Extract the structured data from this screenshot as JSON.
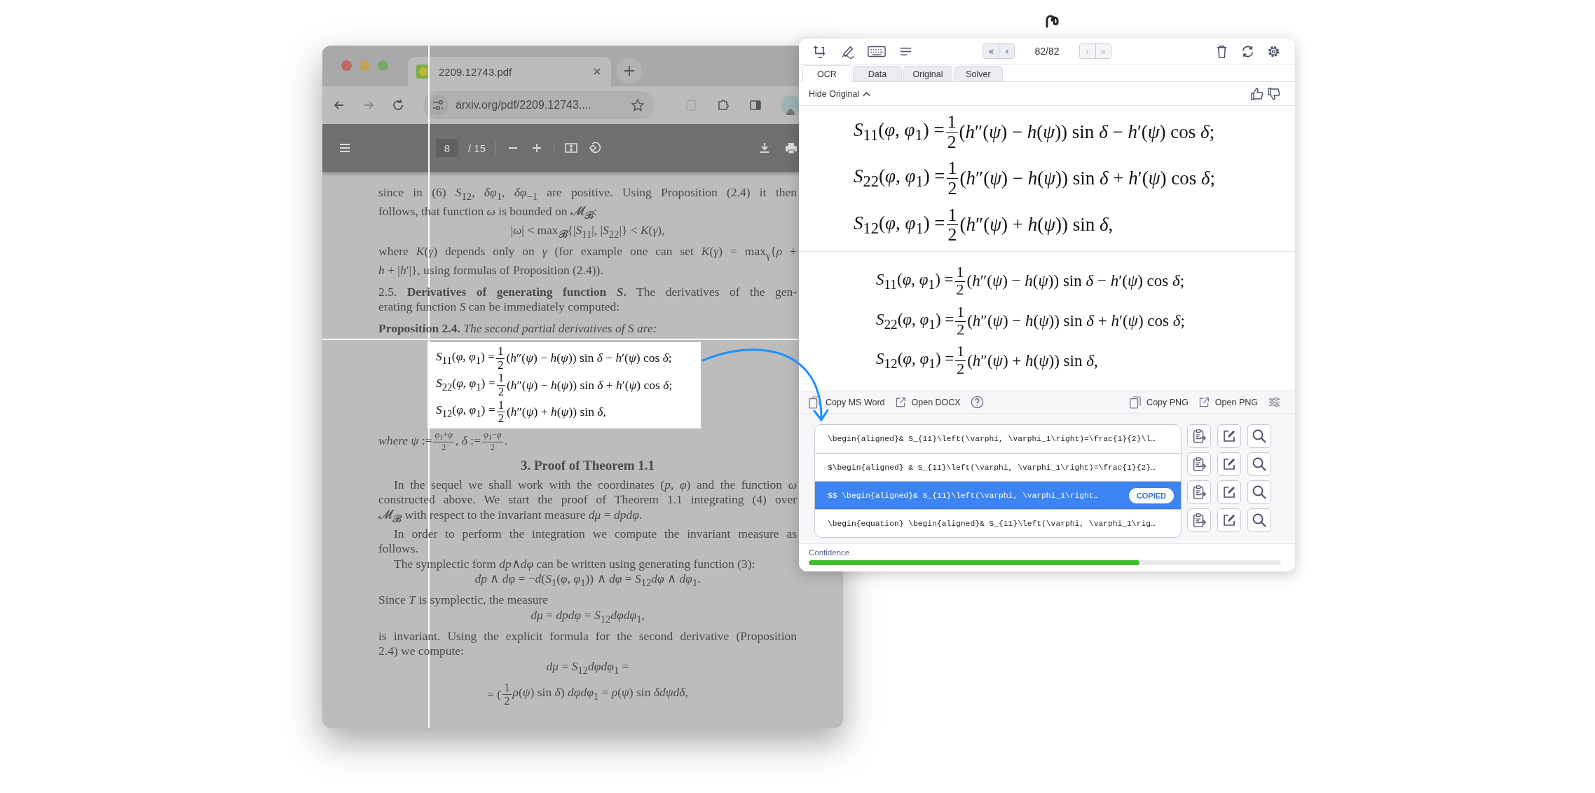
{
  "browser": {
    "tab_title": "2209.12743.pdf",
    "url": "arxiv.org/pdf/2209.12743....",
    "page_number": "8",
    "page_total": "/ 15"
  },
  "pdf_page": {
    "blocks": [
      {
        "kind": "para",
        "lines": [
          "since in (6) *S*$_{12}$, *δφ*$_{1}$, *δφ*$_{−1}$ are positive.  Using Proposition (2.4) it then",
          "follows, that function *ω* is bounded on 𝓜$_{𝓑}$:"
        ]
      },
      {
        "kind": "display",
        "parts": [
          {
            "kind": "text",
            "text": "|*ω*| < max$_{𝓑}${|*S*$_{11}$|, |*S*$_{22}$|} < *K*(*γ*),"
          }
        ]
      },
      {
        "kind": "para",
        "lines": [
          "where *K*(*γ*) depends only on *γ* (for example one can set *K*(*γ*) = max$_{γ}${*ρ* +",
          "*h* + |*h*′|}, using formulas of Proposition (2.4))."
        ]
      },
      {
        "kind": "para",
        "lines": [
          "2.5. **Derivatives of generating function** ***S*.** The derivatives of the gen-",
          "erating function *S* can be immediately computed:"
        ]
      },
      {
        "kind": "para",
        "lines": [
          "**Proposition 2.4.** *The second partial derivatives of S are:*"
        ]
      },
      {
        "kind": "selection",
        "equations": [
          {
            "parts": [
              {
                "kind": "text",
                "text": "*S*$_{11}$(*φ*, *φ*$_{1}$) ="
              },
              {
                "kind": "frac",
                "num": "1",
                "den": "2"
              },
              {
                "kind": "text",
                "text": "(*h*″(*ψ*) − *h*(*ψ*)) sin *δ* − *h*′(*ψ*) cos *δ*;"
              }
            ]
          },
          {
            "parts": [
              {
                "kind": "text",
                "text": "*S*$_{22}$(*φ*, *φ*$_{1}$) ="
              },
              {
                "kind": "frac",
                "num": "1",
                "den": "2"
              },
              {
                "kind": "text",
                "text": "(*h*″(*ψ*) − *h*(*ψ*)) sin *δ* + *h*′(*ψ*) cos *δ*;"
              }
            ]
          },
          {
            "parts": [
              {
                "kind": "text",
                "text": "*S*$_{12}$(*φ*, *φ*$_{1}$) ="
              },
              {
                "kind": "frac",
                "num": "1",
                "den": "2"
              },
              {
                "kind": "text",
                "text": "(*h*″(*ψ*) + *h*(*ψ*)) sin *δ*,"
              }
            ]
          }
        ]
      },
      {
        "kind": "formula_line",
        "parts": [
          {
            "kind": "text",
            "text": "*where ψ* :="
          },
          {
            "kind": "frac",
            "num": "*φ*$_{1}$+*φ*",
            "den": "2"
          },
          {
            "kind": "text",
            "text": ",    *δ* :="
          },
          {
            "kind": "frac",
            "num": "*φ*$_{1}$−*φ*",
            "den": "2"
          },
          {
            "kind": "text",
            "text": "."
          }
        ]
      },
      {
        "kind": "heading",
        "text": "3.  Proof of Theorem 1.1"
      },
      {
        "kind": "indented_para",
        "lines": [
          "In the sequel we shall work with the coordinates (*p*, *φ*) and the function *ω*",
          "constructed above.  We start the proof of Theorem 1.1 integrating (4) over",
          "𝓜$_{𝓑}$ with respect to the invariant measure *dμ* = *dpdφ*."
        ]
      },
      {
        "kind": "indented_para",
        "lines": [
          "In order to perform the integration we compute the invariant measure as",
          "follows."
        ]
      },
      {
        "kind": "indented_para",
        "lines": [
          "The symplectic form *dp*∧*dφ* can be written using generating function (3):"
        ]
      },
      {
        "kind": "display",
        "parts": [
          {
            "kind": "text",
            "text": "*dp* ∧ *dφ* = −*d*(*S*$_{1}$(*φ*, *φ*$_{1}$)) ∧ *dφ* = *S*$_{12}$*dφ* ∧ *dφ*$_{1}$."
          }
        ]
      },
      {
        "kind": "para",
        "lines": [
          "Since *T* is symplectic, the measure"
        ]
      },
      {
        "kind": "display",
        "parts": [
          {
            "kind": "text",
            "text": "*dμ* = *dpdφ* = *S*$_{12}$*dφdφ*$_{1}$,"
          }
        ]
      },
      {
        "kind": "para",
        "lines": [
          "is invariant.  Using the explicit formula for the second derivative (Proposition",
          "2.4) we compute:"
        ]
      },
      {
        "kind": "display",
        "parts": [
          {
            "kind": "text",
            "text": "*dμ* = *S*$_{12}$*dφdφ*$_{1}$ ="
          }
        ]
      },
      {
        "kind": "display",
        "parts": [
          {
            "kind": "text",
            "text": "= ("
          },
          {
            "kind": "frac",
            "num": "1",
            "den": "2"
          },
          {
            "kind": "text",
            "text": "*ρ*(*ψ*) sin *δ*) *dφdφ*$_{1}$ = *ρ*(*ψ*) sin *δdψdδ*,"
          }
        ]
      }
    ]
  },
  "capture_panel": {
    "nav_buttons": [
      {
        "label": "«",
        "disabled": false
      },
      {
        "label": "‹",
        "disabled": false
      },
      {
        "label": "›",
        "disabled": true
      },
      {
        "label": "»",
        "disabled": true
      }
    ],
    "counter": "82/82",
    "tabs": [
      {
        "label": "OCR",
        "selected": true
      },
      {
        "label": "Data",
        "selected": false
      },
      {
        "label": "Original",
        "selected": false
      },
      {
        "label": "Solver",
        "selected": false
      }
    ],
    "hide_original": "Hide Original",
    "original_equations": [
      {
        "parts": [
          {
            "kind": "text",
            "text": "*S*$_{11}$(*φ*, *φ*$_{1}$) ="
          },
          {
            "kind": "frac",
            "num": "1",
            "den": "2"
          },
          {
            "kind": "text",
            "text": "(*h*″(*ψ*) − *h*(*ψ*)) sin *δ* − *h*′(*ψ*) cos *δ*;"
          }
        ]
      },
      {
        "parts": [
          {
            "kind": "text",
            "text": "*S*$_{22}$(*φ*, *φ*$_{1}$) ="
          },
          {
            "kind": "frac",
            "num": "1",
            "den": "2"
          },
          {
            "kind": "text",
            "text": "(*h*″(*ψ*) − *h*(*ψ*)) sin *δ* + *h*′(*ψ*) cos *δ*;"
          }
        ]
      },
      {
        "parts": [
          {
            "kind": "text",
            "text": "*S*$_{12}$(*φ*, *φ*$_{1}$) ="
          },
          {
            "kind": "frac",
            "num": "1",
            "den": "2"
          },
          {
            "kind": "text",
            "text": "(*h*″(*ψ*) + *h*(*ψ*)) sin *δ*,"
          }
        ]
      }
    ],
    "rendered_equations": [
      {
        "parts": [
          {
            "kind": "text",
            "text": "*S*$_{11}$(*φ*, *φ*$_{1}$) ="
          },
          {
            "kind": "frac",
            "num": "1",
            "den": "2"
          },
          {
            "kind": "text",
            "text": "(*h*″(*ψ*) − *h*(*ψ*)) sin *δ* − *h*′(*ψ*) cos *δ*;"
          }
        ]
      },
      {
        "parts": [
          {
            "kind": "text",
            "text": "*S*$_{22}$(*φ*, *φ*$_{1}$) ="
          },
          {
            "kind": "frac",
            "num": "1",
            "den": "2"
          },
          {
            "kind": "text",
            "text": "(*h*″(*ψ*) − *h*(*ψ*)) sin *δ* + *h*′(*ψ*) cos *δ*;"
          }
        ]
      },
      {
        "parts": [
          {
            "kind": "text",
            "text": "*S*$_{12}$(*φ*, *φ*$_{1}$) ="
          },
          {
            "kind": "frac",
            "num": "1",
            "den": "2"
          },
          {
            "kind": "text",
            "text": "(*h*″(*ψ*) + *h*(*ψ*)) sin *δ*,"
          }
        ]
      }
    ],
    "actions_left": [
      "Copy MS Word",
      "Open DOCX"
    ],
    "actions_right": [
      "Copy PNG",
      "Open PNG"
    ],
    "results": [
      {
        "text": "\\begin{aligned}& S_{11}\\left(\\varphi, \\varphi_1\\right)=\\frac{1}{2}\\l…",
        "selected": false
      },
      {
        "text": "$\\begin{aligned} & S_{11}\\left(\\varphi, \\varphi_1\\right)=\\frac{1}{2}…",
        "selected": false
      },
      {
        "text": "$$ \\begin{aligned}& S_{11}\\left(\\varphi, \\varphi_1\\right…",
        "selected": true,
        "badge": "COPIED"
      },
      {
        "text": "\\begin{equation} \\begin{aligned}& S_{11}\\left(\\varphi, \\varphi_1\\rig…",
        "selected": false
      }
    ],
    "confidence": {
      "label": "Confidence",
      "level": 0.7
    }
  }
}
